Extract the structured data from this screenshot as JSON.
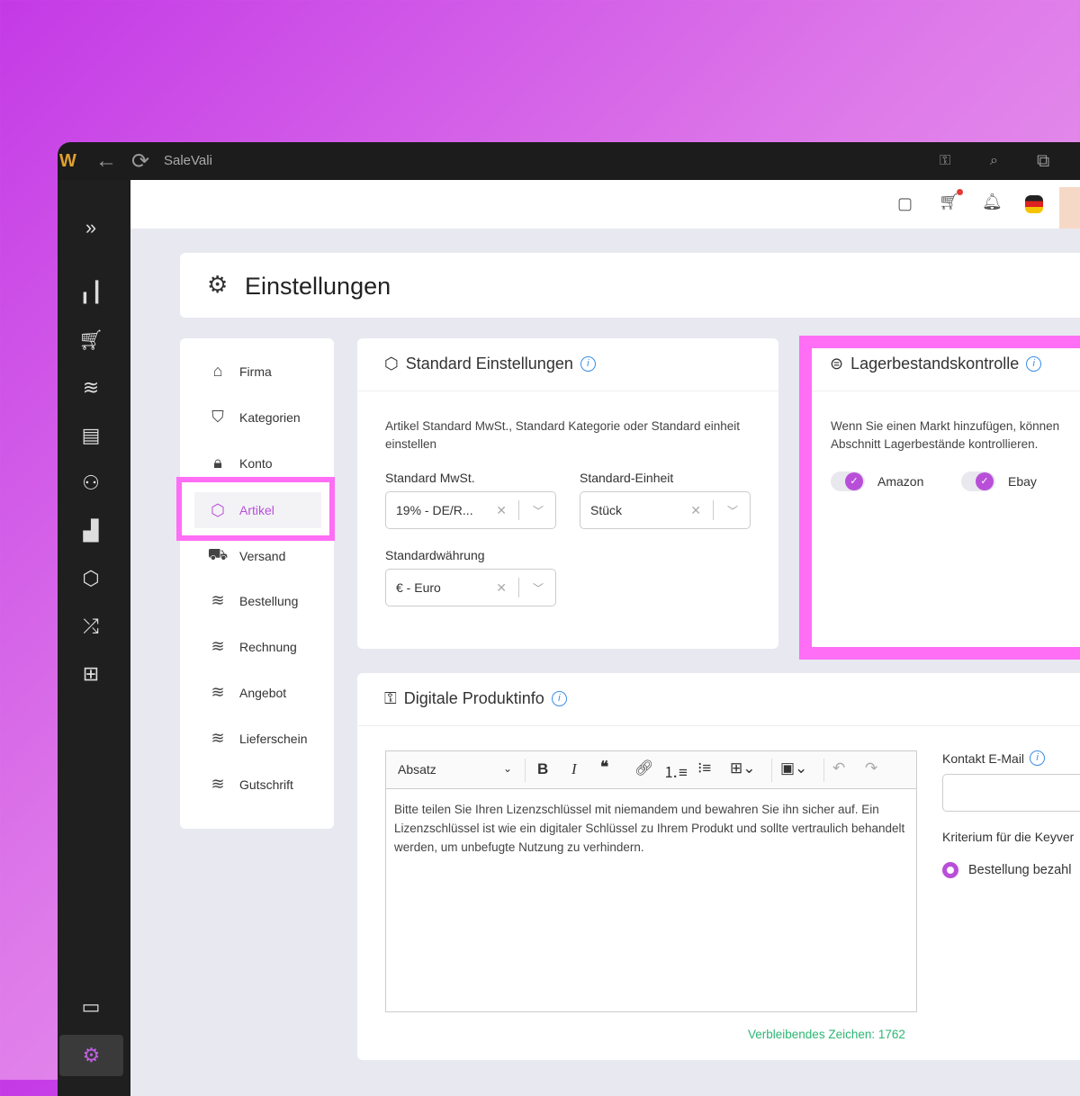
{
  "app": {
    "title": "SaleVali"
  },
  "page": {
    "title": "Einstellungen"
  },
  "settings_menu": [
    {
      "label": "Firma",
      "icon": "home-icon"
    },
    {
      "label": "Kategorien",
      "icon": "bookmark-icon"
    },
    {
      "label": "Konto",
      "icon": "lock-icon"
    },
    {
      "label": "Artikel",
      "icon": "box-icon",
      "active": true
    },
    {
      "label": "Versand",
      "icon": "truck-icon"
    },
    {
      "label": "Bestellung",
      "icon": "layers-icon"
    },
    {
      "label": "Rechnung",
      "icon": "layers-icon"
    },
    {
      "label": "Angebot",
      "icon": "layers-icon"
    },
    {
      "label": "Lieferschein",
      "icon": "layers-icon"
    },
    {
      "label": "Gutschrift",
      "icon": "layers-icon"
    }
  ],
  "standard": {
    "title": "Standard Einstellungen",
    "description": "Artikel Standard MwSt., Standard Kategorie oder Standard einheit einstellen",
    "mwst_label": "Standard MwSt.",
    "mwst_value": "19% - DE/R...",
    "unit_label": "Standard-Einheit",
    "unit_value": "Stück",
    "currency_label": "Standardwährung",
    "currency_value": "€ - Euro"
  },
  "stock": {
    "title": "Lagerbestandskontrolle",
    "description": "Wenn Sie einen Markt hinzufügen, können Abschnitt Lagerbestände kontrollieren.",
    "markets": [
      {
        "label": "Amazon",
        "on": true
      },
      {
        "label": "Ebay",
        "on": true
      }
    ]
  },
  "digital": {
    "title": "Digitale Produktinfo",
    "format": "Absatz",
    "text": "Bitte teilen Sie Ihren Lizenzschlüssel mit niemandem und bewahren Sie ihn sicher auf. Ein Lizenzschlüssel ist wie ein digitaler Schlüssel zu Ihrem Produkt und sollte vertraulich behandelt werden, um unbefugte Nutzung zu verhindern.",
    "remaining": "Verbleibendes Zeichen: 1762",
    "email_label": "Kontakt E-Mail",
    "email_value": "",
    "criterion_label": "Kriterium für die Keyver",
    "criterion_option": "Bestellung bezahl"
  },
  "colors": {
    "accent": "#b94fd9",
    "highlight": "#ff6ef5",
    "remaining": "#2bb673"
  }
}
